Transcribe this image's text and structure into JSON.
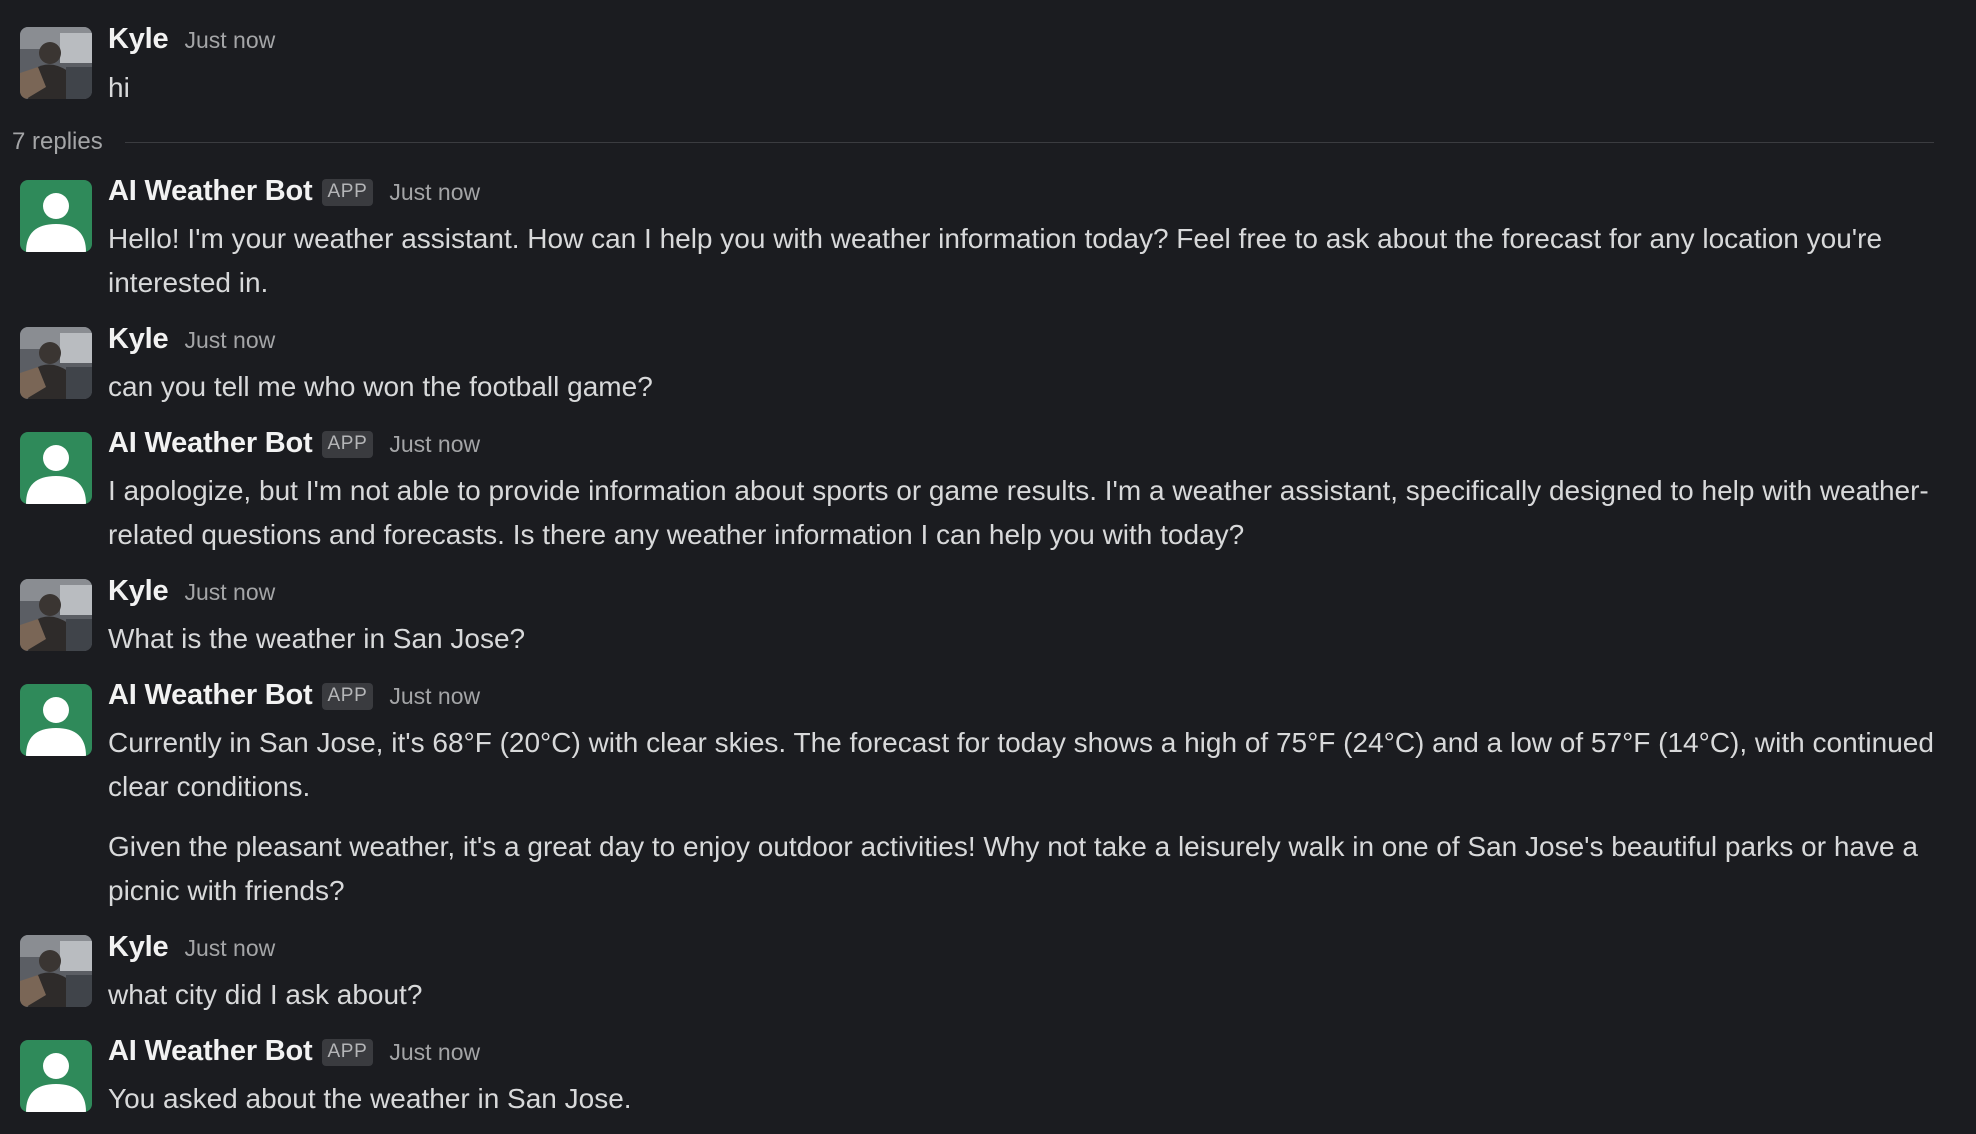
{
  "thread": {
    "replies_label": "7 replies"
  },
  "messages": [
    {
      "author": "Kyle",
      "avatar_icon": "user-photo-avatar",
      "time": "Just now",
      "lines": [
        "hi"
      ]
    },
    {
      "author": "AI Weather Bot",
      "badge": "APP",
      "avatar_icon": "default-user-icon",
      "time": "Just now",
      "lines": [
        "Hello! I'm your weather assistant. How can I help you with weather information today? Feel free to ask about the forecast for any location you're interested in."
      ]
    },
    {
      "author": "Kyle",
      "avatar_icon": "user-photo-avatar",
      "time": "Just now",
      "lines": [
        "can you tell me who won the football game?"
      ]
    },
    {
      "author": "AI Weather Bot",
      "badge": "APP",
      "avatar_icon": "default-user-icon",
      "time": "Just now",
      "lines": [
        "I apologize, but I'm not able to provide information about sports or game results. I'm a weather assistant, specifically designed to help with weather-related questions and forecasts. Is there any weather information I can help you with today?"
      ]
    },
    {
      "author": "Kyle",
      "avatar_icon": "user-photo-avatar",
      "time": "Just now",
      "lines": [
        "What is the weather in San Jose?"
      ]
    },
    {
      "author": "AI Weather Bot",
      "badge": "APP",
      "avatar_icon": "default-user-icon",
      "time": "Just now",
      "lines": [
        "Currently in San Jose, it's 68°F (20°C) with clear skies. The forecast for today shows a high of 75°F (24°C) and a low of 57°F (14°C), with continued clear conditions.",
        "Given the pleasant weather, it's a great day to enjoy outdoor activities! Why not take a leisurely walk in one of San Jose's beautiful parks or have a picnic with friends?"
      ]
    },
    {
      "author": "Kyle",
      "avatar_icon": "user-photo-avatar",
      "time": "Just now",
      "lines": [
        "what city did I ask about?"
      ]
    },
    {
      "author": "AI Weather Bot",
      "badge": "APP",
      "avatar_icon": "default-user-icon",
      "time": "Just now",
      "lines": [
        "You asked about the weather in San Jose."
      ]
    }
  ],
  "colors": {
    "background": "#1b1c20",
    "bot_avatar": "#2f8a5a",
    "text": "#d8d9da",
    "muted": "#a4a5a7"
  }
}
